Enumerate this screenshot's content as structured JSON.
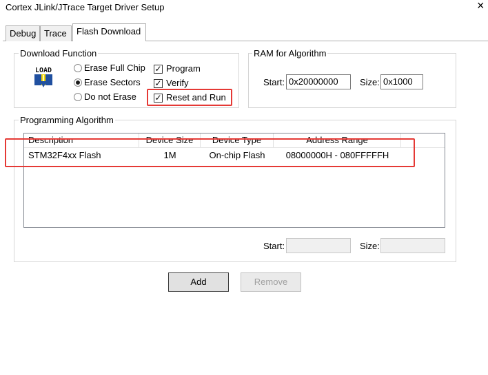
{
  "window": {
    "title": "Cortex JLink/JTrace Target Driver Setup",
    "close_glyph": "×"
  },
  "tabs": [
    {
      "label": "Debug"
    },
    {
      "label": "Trace"
    },
    {
      "label": "Flash Download"
    }
  ],
  "active_tab": "Flash Download",
  "download_function": {
    "label": "Download Function",
    "icon_text": "LOAD",
    "erase_options": [
      {
        "label": "Erase Full Chip",
        "selected": false
      },
      {
        "label": "Erase Sectors",
        "selected": true
      },
      {
        "label": "Do not Erase",
        "selected": false
      }
    ],
    "actions": [
      {
        "label": "Program",
        "checked": true
      },
      {
        "label": "Verify",
        "checked": true
      },
      {
        "label": "Reset and Run",
        "checked": true
      }
    ]
  },
  "ram_for_algorithm": {
    "label": "RAM for Algorithm",
    "start_label": "Start:",
    "start_value": "0x20000000",
    "size_label": "Size:",
    "size_value": "0x1000"
  },
  "programming_algorithm": {
    "label": "Programming Algorithm",
    "columns": [
      "Description",
      "Device Size",
      "Device Type",
      "Address Range"
    ],
    "rows": [
      {
        "description": "STM32F4xx Flash",
        "device_size": "1M",
        "device_type": "On-chip Flash",
        "address_range": "08000000H - 080FFFFFH"
      }
    ],
    "start_label": "Start:",
    "start_value": "",
    "size_label": "Size:",
    "size_value": ""
  },
  "buttons": {
    "add": "Add",
    "remove": "Remove"
  },
  "annotation_color": "#e53935"
}
